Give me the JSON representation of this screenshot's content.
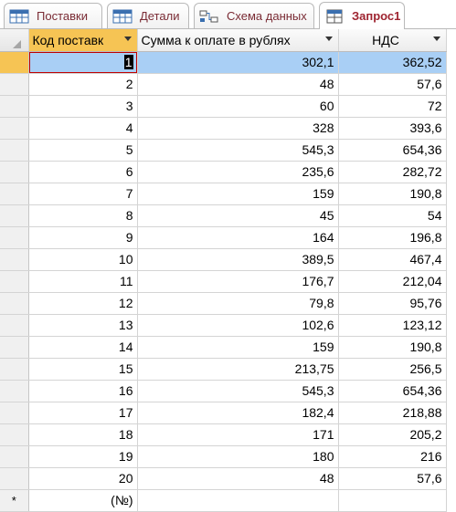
{
  "tabs": [
    {
      "label": "Поставки",
      "icon": "table-icon",
      "active": false
    },
    {
      "label": "Детали",
      "icon": "table-icon",
      "active": false
    },
    {
      "label": "Схема данных",
      "icon": "relationships-icon",
      "active": false
    },
    {
      "label": "Запрос1",
      "icon": "query-icon",
      "active": true
    }
  ],
  "columns": [
    {
      "label": "Код поставк",
      "has_dropdown": true,
      "selected": true
    },
    {
      "label": "Сумма к оплате в рублях",
      "has_dropdown": true,
      "selected": false
    },
    {
      "label": "НДС",
      "has_dropdown": true,
      "selected": false
    }
  ],
  "rows": [
    {
      "id": "1",
      "sum": "302,1",
      "vat": "362,52"
    },
    {
      "id": "2",
      "sum": "48",
      "vat": "57,6"
    },
    {
      "id": "3",
      "sum": "60",
      "vat": "72"
    },
    {
      "id": "4",
      "sum": "328",
      "vat": "393,6"
    },
    {
      "id": "5",
      "sum": "545,3",
      "vat": "654,36"
    },
    {
      "id": "6",
      "sum": "235,6",
      "vat": "282,72"
    },
    {
      "id": "7",
      "sum": "159",
      "vat": "190,8"
    },
    {
      "id": "8",
      "sum": "45",
      "vat": "54"
    },
    {
      "id": "9",
      "sum": "164",
      "vat": "196,8"
    },
    {
      "id": "10",
      "sum": "389,5",
      "vat": "467,4"
    },
    {
      "id": "11",
      "sum": "176,7",
      "vat": "212,04"
    },
    {
      "id": "12",
      "sum": "79,8",
      "vat": "95,76"
    },
    {
      "id": "13",
      "sum": "102,6",
      "vat": "123,12"
    },
    {
      "id": "14",
      "sum": "159",
      "vat": "190,8"
    },
    {
      "id": "15",
      "sum": "213,75",
      "vat": "256,5"
    },
    {
      "id": "16",
      "sum": "545,3",
      "vat": "654,36"
    },
    {
      "id": "17",
      "sum": "182,4",
      "vat": "218,88"
    },
    {
      "id": "18",
      "sum": "171",
      "vat": "205,2"
    },
    {
      "id": "19",
      "sum": "180",
      "vat": "216"
    },
    {
      "id": "20",
      "sum": "48",
      "vat": "57,6"
    }
  ],
  "new_row": {
    "marker": "*",
    "id": "(№)"
  },
  "current_row_index": 0,
  "colors": {
    "accent_header": "#f6c454",
    "current_row": "#a9cff5",
    "tab_text": "#7a2b34"
  }
}
